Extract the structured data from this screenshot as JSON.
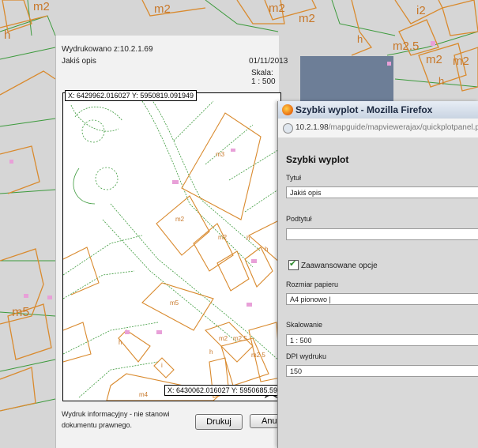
{
  "background_map": {
    "labels": [
      "m2",
      "m2",
      "m2",
      "m2",
      "h",
      "i2",
      "m2.5",
      "m2",
      "m2",
      "h",
      "h",
      "m5"
    ]
  },
  "preview": {
    "printed_from": "Wydrukowano z:10.2.1.69",
    "description": "Jakiś opis",
    "date": "01/11/2013",
    "scale": "Skala: 1 : 500",
    "coord_top": "X: 6429962.016027 Y: 5950819.091949",
    "coord_bottom": "X: 6430062.016027 Y: 5950685.59",
    "map_labels": [
      "m3",
      "m2",
      "m2",
      "h",
      "h",
      "m5",
      "h",
      "m2",
      "m2.5",
      "m2.5",
      "i",
      "h",
      "m4"
    ],
    "disclaimer_line1": "Wydruk informacyjny - nie stanowi",
    "disclaimer_line2": "dokumentu prawnego.",
    "print_button": "Drukuj",
    "cancel_button": "Anu"
  },
  "firefox": {
    "title": "Szybki wyplot - Mozilla Firefox",
    "url_host": "10.2.1.98",
    "url_path": "/mapguide/mapviewerajax/quickplotpanel.php",
    "form_heading": "Szybki wyplot",
    "title_label": "Tytuł",
    "title_value": "Jakiś opis",
    "subtitle_label": "Podtytuł",
    "subtitle_value": "",
    "advanced_label": "Zaawansowane opcje",
    "advanced_checked": true,
    "paper_label": "Rozmiar papieru",
    "paper_value": "A4 pionowo |",
    "scale_label": "Skalowanie",
    "scale_value": "1 : 500",
    "dpi_label": "DPI wydruku",
    "dpi_value": "150"
  },
  "colors": {
    "orange": "#d98a2e",
    "green": "#3c9a3c",
    "map_bg": "#d6d6d6"
  }
}
